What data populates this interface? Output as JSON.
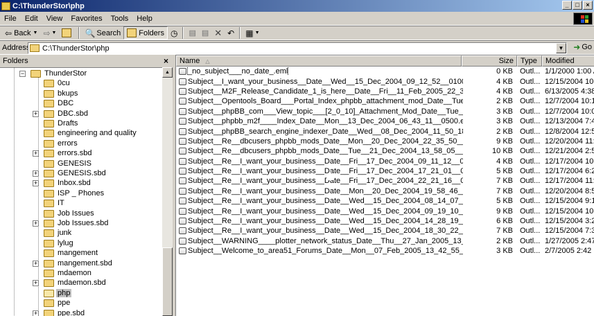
{
  "window": {
    "title": "C:\\ThunderStor\\php"
  },
  "menu": [
    "File",
    "Edit",
    "View",
    "Favorites",
    "Tools",
    "Help"
  ],
  "toolbar": {
    "back": "Back",
    "search": "Search",
    "folders": "Folders"
  },
  "address": {
    "label": "Address",
    "value": "C:\\ThunderStor\\php",
    "go": "Go"
  },
  "folders_pane": {
    "title": "Folders",
    "root": "ThunderStor",
    "items": [
      {
        "name": "0cu",
        "expandable": false,
        "selected": false
      },
      {
        "name": "bkups",
        "expandable": false,
        "selected": false
      },
      {
        "name": "DBC",
        "expandable": false,
        "selected": false
      },
      {
        "name": "DBC.sbd",
        "expandable": true,
        "selected": false
      },
      {
        "name": "Drafts",
        "expandable": false,
        "selected": false
      },
      {
        "name": "engineering and quality",
        "expandable": false,
        "selected": false
      },
      {
        "name": "errors",
        "expandable": false,
        "selected": false
      },
      {
        "name": "errors.sbd",
        "expandable": true,
        "selected": false
      },
      {
        "name": "GENESIS",
        "expandable": false,
        "selected": false
      },
      {
        "name": "GENESIS.sbd",
        "expandable": true,
        "selected": false
      },
      {
        "name": "Inbox.sbd",
        "expandable": true,
        "selected": false
      },
      {
        "name": "ISP _ Phones",
        "expandable": false,
        "selected": false
      },
      {
        "name": "IT",
        "expandable": false,
        "selected": false
      },
      {
        "name": "Job Issues",
        "expandable": false,
        "selected": false
      },
      {
        "name": "Job Issues.sbd",
        "expandable": true,
        "selected": false
      },
      {
        "name": "junk",
        "expandable": false,
        "selected": false
      },
      {
        "name": "lylug",
        "expandable": false,
        "selected": false
      },
      {
        "name": "mangement",
        "expandable": false,
        "selected": false
      },
      {
        "name": "mangement.sbd",
        "expandable": true,
        "selected": false
      },
      {
        "name": "mdaemon",
        "expandable": false,
        "selected": false
      },
      {
        "name": "mdaemon.sbd",
        "expandable": true,
        "selected": false
      },
      {
        "name": "php",
        "expandable": false,
        "selected": true
      },
      {
        "name": "ppe",
        "expandable": false,
        "selected": false
      },
      {
        "name": "ppe.sbd",
        "expandable": true,
        "selected": false
      }
    ]
  },
  "file_list": {
    "columns": {
      "name": "Name",
      "size": "Size",
      "type": "Type",
      "modified": "Modified"
    },
    "rows": [
      {
        "name": "_no_subject___no_date_.eml",
        "size": "0 KB",
        "type": "Outl...",
        "modified": "1/1/2000 1:00 A"
      },
      {
        "name": "Subject__I_want_your_business__Date__Wed__15_Dec_2004_09_12_52__0100.eml",
        "size": "4 KB",
        "type": "Outl...",
        "modified": "12/15/2004 10:1"
      },
      {
        "name": "Subject__M2F_Release_Candidate_1_is_here__Date__Fri__11_Feb_2005_22_39_35_UT.eml",
        "size": "4 KB",
        "type": "Outl...",
        "modified": "6/13/2005 4:38 P"
      },
      {
        "name": "Subject__Opentools_Board___Portal_Index_phpbb_attachment_mod_Date__Tue__07_Dec_...",
        "size": "2 KB",
        "type": "Outl...",
        "modified": "12/7/2004 10:12"
      },
      {
        "name": "Subject__phpBB_com___View_topic___[2_0_10]_Attachment_Mod_Date__Tue__07_Dec_2...",
        "size": "3 KB",
        "type": "Outl...",
        "modified": "12/7/2004 10:09"
      },
      {
        "name": "Subject__phpbb_m2f____Index_Date__Mon__13_Dec_2004_06_43_11__0500.eml",
        "size": "3 KB",
        "type": "Outl...",
        "modified": "12/13/2004 7:43"
      },
      {
        "name": "Subject__phpBB_search_engine_indexer_Date__Wed__08_Dec_2004_11_50_18__0500.eml",
        "size": "2 KB",
        "type": "Outl...",
        "modified": "12/8/2004 12:50"
      },
      {
        "name": "Subject__Re__dbcusers_phpbb_mods_Date__Mon__20_Dec_2004_22_35_50__0100.eml",
        "size": "9 KB",
        "type": "Outl...",
        "modified": "12/20/2004 11:3"
      },
      {
        "name": "Subject__Re__dbcusers_phpbb_mods_Date__Tue__21_Dec_2004_13_58_05__0100.eml",
        "size": "10 KB",
        "type": "Outl...",
        "modified": "12/21/2004 2:58"
      },
      {
        "name": "Subject__Re__I_want_your_business__Date__Fri__17_Dec_2004_09_11_12__0100.eml",
        "size": "4 KB",
        "type": "Outl...",
        "modified": "12/17/2004 10:1"
      },
      {
        "name": "Subject__Re__I_want_your_business__Date__Fri__17_Dec_2004_17_21_01__0100.eml",
        "size": "5 KB",
        "type": "Outl...",
        "modified": "12/17/2004 6:21"
      },
      {
        "name": "Subject__Re__I_want_your_business__Date__Fri__17_Dec_2004_22_21_16__0100.eml",
        "size": "7 KB",
        "type": "Outl...",
        "modified": "12/17/2004 11:2"
      },
      {
        "name": "Subject__Re__I_want_your_business__Date__Mon__20_Dec_2004_19_58_46__0100.eml",
        "size": "7 KB",
        "type": "Outl...",
        "modified": "12/20/2004 8:58"
      },
      {
        "name": "Subject__Re__I_want_your_business__Date__Wed__15_Dec_2004_08_14_07__0500.eml",
        "size": "5 KB",
        "type": "Outl...",
        "modified": "12/15/2004 9:14"
      },
      {
        "name": "Subject__Re__I_want_your_business__Date__Wed__15_Dec_2004_09_19_10__0500.eml",
        "size": "9 KB",
        "type": "Outl...",
        "modified": "12/15/2004 10:1"
      },
      {
        "name": "Subject__Re__I_want_your_business__Date__Wed__15_Dec_2004_14_28_19__0100.eml",
        "size": "6 KB",
        "type": "Outl...",
        "modified": "12/15/2004 3:28"
      },
      {
        "name": "Subject__Re__I_want_your_business__Date__Wed__15_Dec_2004_18_30_22__0100.eml",
        "size": "7 KB",
        "type": "Outl...",
        "modified": "12/15/2004 7:30"
      },
      {
        "name": "Subject__WARNING____plotter_network_status_Date__Thu__27_Jan_2005_13_47_31__05...",
        "size": "2 KB",
        "type": "Outl...",
        "modified": "1/27/2005 2:47 P"
      },
      {
        "name": "Subject__Welcome_to_area51_Forums_Date__Mon__07_Feb_2005_13_42_55_GMT.eml",
        "size": "3 KB",
        "type": "Outl...",
        "modified": "2/7/2005 2:42 P"
      }
    ]
  }
}
